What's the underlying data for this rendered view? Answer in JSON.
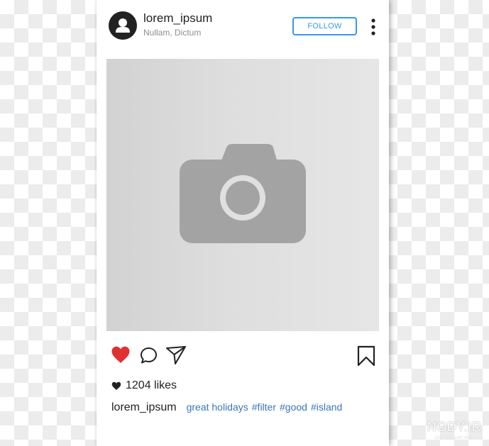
{
  "post": {
    "header": {
      "username": "lorem_ipsum",
      "location": "Nullam, Dictum",
      "follow_label": "FOLLOW",
      "avatar_icon": "user-silhouette-icon",
      "more_icon": "vertical-dots-icon"
    },
    "image": {
      "placeholder_icon": "camera-icon"
    },
    "actions": {
      "like_icon": "heart-icon",
      "like_active": true,
      "comment_icon": "speech-bubble-icon",
      "share_icon": "paper-plane-icon",
      "save_icon": "bookmark-icon"
    },
    "likes": {
      "icon": "heart-icon",
      "count_text": "1204 likes"
    },
    "caption": {
      "username": "lorem_ipsum",
      "text": "great holidays",
      "hashtags": [
        "#filter",
        "#good",
        "#island"
      ]
    }
  },
  "watermark": {
    "main": "NODY.IR",
    "sub": "مجله تصویری نودی"
  },
  "colors": {
    "accent": "#3897f0",
    "like_red": "#e03131",
    "hashtag": "#3a76b8",
    "text": "#222222",
    "muted": "#8e8e8e",
    "photo_placeholder": "#dcdcdc",
    "camera_glyph": "#a3a3a3"
  }
}
